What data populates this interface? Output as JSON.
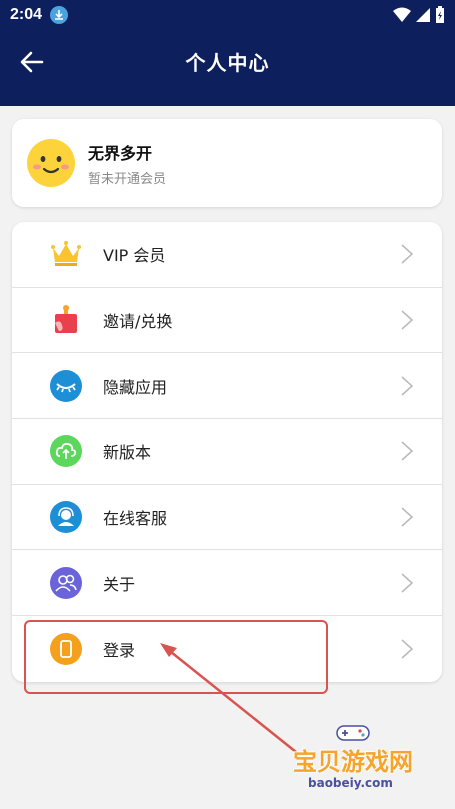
{
  "status_bar": {
    "time": "2:04"
  },
  "header": {
    "title": "个人中心"
  },
  "profile": {
    "name": "无界多开",
    "membership": "暂未开通会员"
  },
  "menu": [
    {
      "label": "VIP 会员",
      "icon": "crown-icon"
    },
    {
      "label": "邀请/兑换",
      "icon": "gift-icon"
    },
    {
      "label": "隐藏应用",
      "icon": "eye-closed-icon"
    },
    {
      "label": "新版本",
      "icon": "cloud-upload-icon"
    },
    {
      "label": "在线客服",
      "icon": "headset-icon"
    },
    {
      "label": "关于",
      "icon": "users-icon"
    },
    {
      "label": "登录",
      "icon": "phone-icon"
    }
  ],
  "watermark": {
    "title": "宝贝游戏网",
    "url": "baobeiy.com"
  },
  "colors": {
    "header": "#0d1f5c",
    "highlight": "#d9534f",
    "watermark": "#f6a42c"
  }
}
